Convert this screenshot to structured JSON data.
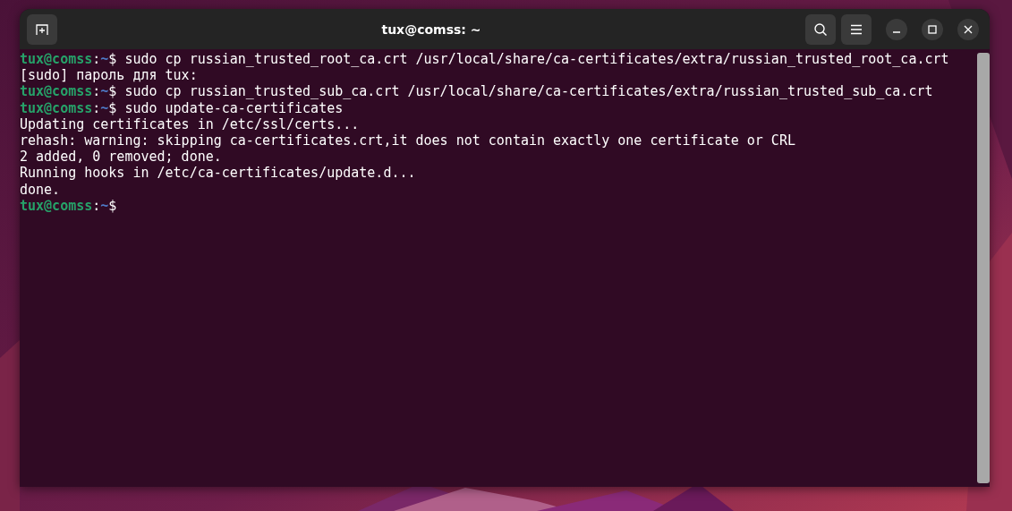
{
  "window": {
    "title": "tux@comss: ~"
  },
  "terminal": {
    "lines": [
      {
        "kind": "prompt",
        "user": "tux@comss",
        "sep": ":",
        "path": "~",
        "symbol": "$",
        "command": " sudo cp russian_trusted_root_ca.crt /usr/local/share/ca-certificates/extra/russian_trusted_root_ca.crt"
      },
      {
        "kind": "output",
        "text": "[sudo] пароль для tux:"
      },
      {
        "kind": "prompt",
        "user": "tux@comss",
        "sep": ":",
        "path": "~",
        "symbol": "$",
        "command": " sudo cp russian_trusted_sub_ca.crt /usr/local/share/ca-certificates/extra/russian_trusted_sub_ca.crt"
      },
      {
        "kind": "prompt",
        "user": "tux@comss",
        "sep": ":",
        "path": "~",
        "symbol": "$",
        "command": " sudo update-ca-certificates"
      },
      {
        "kind": "output",
        "text": "Updating certificates in /etc/ssl/certs..."
      },
      {
        "kind": "output",
        "text": "rehash: warning: skipping ca-certificates.crt,it does not contain exactly one certificate or CRL"
      },
      {
        "kind": "output",
        "text": "2 added, 0 removed; done."
      },
      {
        "kind": "output",
        "text": "Running hooks in /etc/ca-certificates/update.d..."
      },
      {
        "kind": "output",
        "text": "done."
      },
      {
        "kind": "prompt",
        "user": "tux@comss",
        "sep": ":",
        "path": "~",
        "symbol": "$"
      }
    ]
  }
}
